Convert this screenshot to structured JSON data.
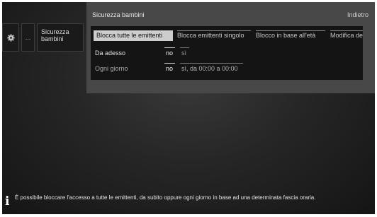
{
  "sidebar": {
    "gear_icon": "gear-icon",
    "more_label": "...",
    "active_item": "Sicurezza bambini"
  },
  "panel": {
    "title": "Sicurezza bambini",
    "back_label": "Indietro",
    "tabs": [
      {
        "label": "Blocca tutte le emittenti",
        "selected": true
      },
      {
        "label": "Blocca emittenti singolo",
        "selected": false
      },
      {
        "label": "Blocco in base all'età",
        "selected": false
      },
      {
        "label": "Modifica del",
        "selected": false
      }
    ],
    "rows": [
      {
        "label": "Da adesso",
        "selected_value": "no",
        "other_value": "sì"
      },
      {
        "label": "Ogni giorno",
        "selected_value": "no",
        "other_value": "sì, da 00:00 a 00:00"
      }
    ]
  },
  "info": {
    "icon": "info-icon",
    "text": "È possibile bloccare l'accesso a tutte le emittenti, da subito oppure ogni giorno in base ad una determinata fascia oraria."
  },
  "colors": {
    "panel": "#484848",
    "selected_tab": "#cdcdcd",
    "background": "#262626"
  }
}
